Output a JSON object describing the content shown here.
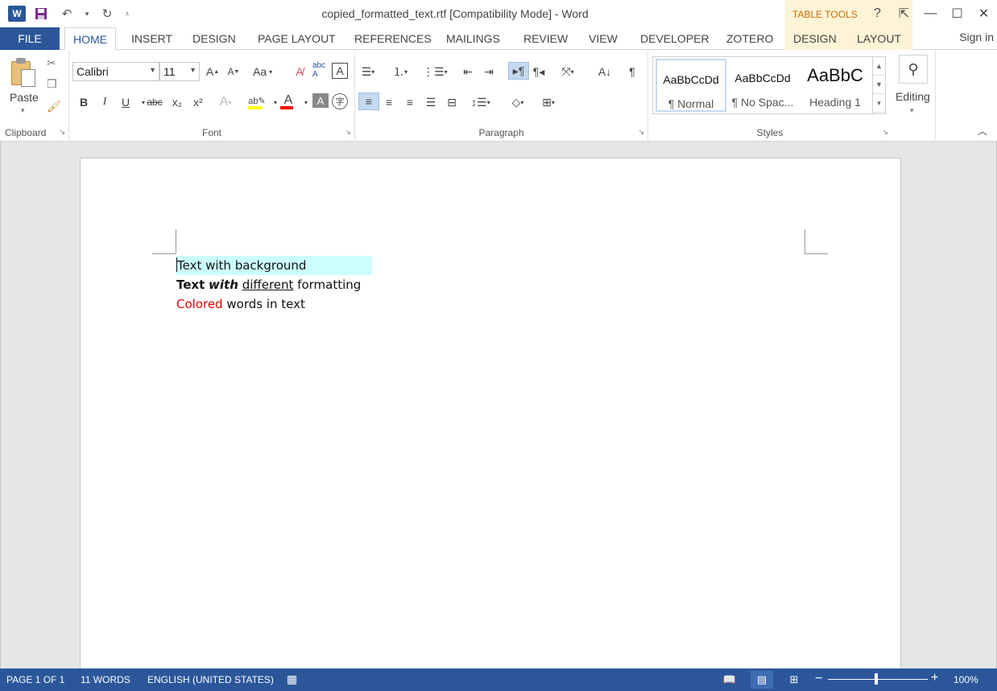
{
  "window": {
    "title": "copied_formatted_text.rtf [Compatibility Mode] - Word",
    "logo_letter": "W",
    "contextual_group": "TABLE TOOLS",
    "controls": [
      "?",
      "⇱",
      "—",
      "☐",
      "✕"
    ]
  },
  "tabs": [
    {
      "label": "FILE"
    },
    {
      "label": "HOME"
    },
    {
      "label": "INSERT"
    },
    {
      "label": "DESIGN"
    },
    {
      "label": "PAGE LAYOUT"
    },
    {
      "label": "REFERENCES"
    },
    {
      "label": "MAILINGS"
    },
    {
      "label": "REVIEW"
    },
    {
      "label": "VIEW"
    },
    {
      "label": "DEVELOPER"
    },
    {
      "label": "ZOTERO"
    },
    {
      "label": "DESIGN"
    },
    {
      "label": "LAYOUT"
    }
  ],
  "active_tab": "HOME",
  "sign_in": "Sign in",
  "ribbon": {
    "clipboard": {
      "label": "Clipboard",
      "paste": "Paste"
    },
    "font": {
      "label": "Font",
      "font_name": "Calibri",
      "font_size": "11",
      "bold": "B",
      "italic": "I",
      "underline": "U",
      "strike": "abc",
      "subscript": "x₂",
      "superscript": "x²",
      "change_case": "Aa"
    },
    "paragraph": {
      "label": "Paragraph"
    },
    "styles": {
      "label": "Styles",
      "items": [
        {
          "sample": "AaBbCcDd",
          "name": "¶ Normal",
          "selected": true
        },
        {
          "sample": "AaBbCcDd",
          "name": "¶ No Spac...",
          "selected": false
        },
        {
          "sample": "AaBbC",
          "name": "Heading 1",
          "selected": false
        }
      ]
    },
    "editing": {
      "label": "Editing"
    },
    "colors": {
      "highlight": "#ffff00",
      "font_color": "#ff0000"
    }
  },
  "document": {
    "line1": "Text with background",
    "line1_bg": "#ccffff",
    "line2": {
      "bold": "Text",
      "bold_italic": "with",
      "underline": "different",
      "plain": "formatting"
    },
    "line3": {
      "colored": "Colored",
      "rest": "words in text",
      "color": "#e00000"
    }
  },
  "status": {
    "page": "PAGE 1 OF 1",
    "words": "11 WORDS",
    "language": "ENGLISH (UNITED STATES)",
    "zoom": "100%",
    "zoom_minus": "−",
    "zoom_plus": "+"
  },
  "accent": "#2b579a"
}
